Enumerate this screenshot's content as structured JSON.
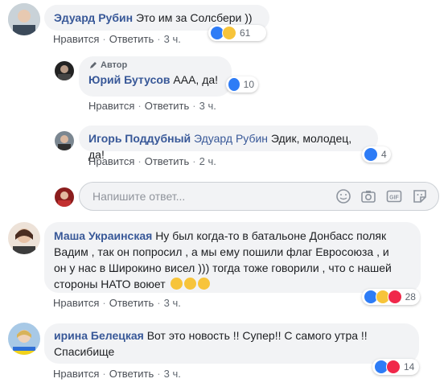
{
  "comments": [
    {
      "author": "Эдуард Рубин",
      "text": "Это им за Солсбери ))",
      "like": "Нравится",
      "reply": "Ответить",
      "time": "3 ч.",
      "reactions_count": "61",
      "replies": [
        {
          "badge": "Автор",
          "author": "Юрий Бутусов",
          "text": "ААА, да!",
          "like": "Нравится",
          "reply": "Ответить",
          "time": "3 ч.",
          "reactions_count": "10"
        },
        {
          "author": "Игорь Поддубный",
          "mention": "Эдуард Рубин",
          "text": "Эдик, молодец, да!",
          "like": "Нравится",
          "reply": "Ответить",
          "time": "2 ч.",
          "reactions_count": "4"
        }
      ]
    },
    {
      "author": "Маша Украинская",
      "text_lines": [
        "Ну был когда-то в батальоне Донбасс поляк",
        "Вадим , так он попросил , а мы ему пошили флаг Евросоюза , и",
        "он у нас в Широкино висел ))) тогда тоже говорили , что с нашей",
        "стороны НАТО воюет"
      ],
      "like": "Нравится",
      "reply": "Ответить",
      "time": "3 ч.",
      "reactions_count": "28"
    },
    {
      "author": "ирина Белецкая",
      "text_lines": [
        "Вот это новость !! Супер!! С самого утра !!",
        "Спасибище"
      ],
      "like": "Нравится",
      "reply": "Ответить",
      "time": "3 ч.",
      "reactions_count": "14"
    }
  ],
  "reply_box": {
    "placeholder": "Напишите ответ..."
  },
  "colors": {
    "link": "#385898",
    "bubble": "#f2f3f5",
    "like": "#2e7cf6",
    "haha": "#f7c43a",
    "love": "#f0284a"
  }
}
